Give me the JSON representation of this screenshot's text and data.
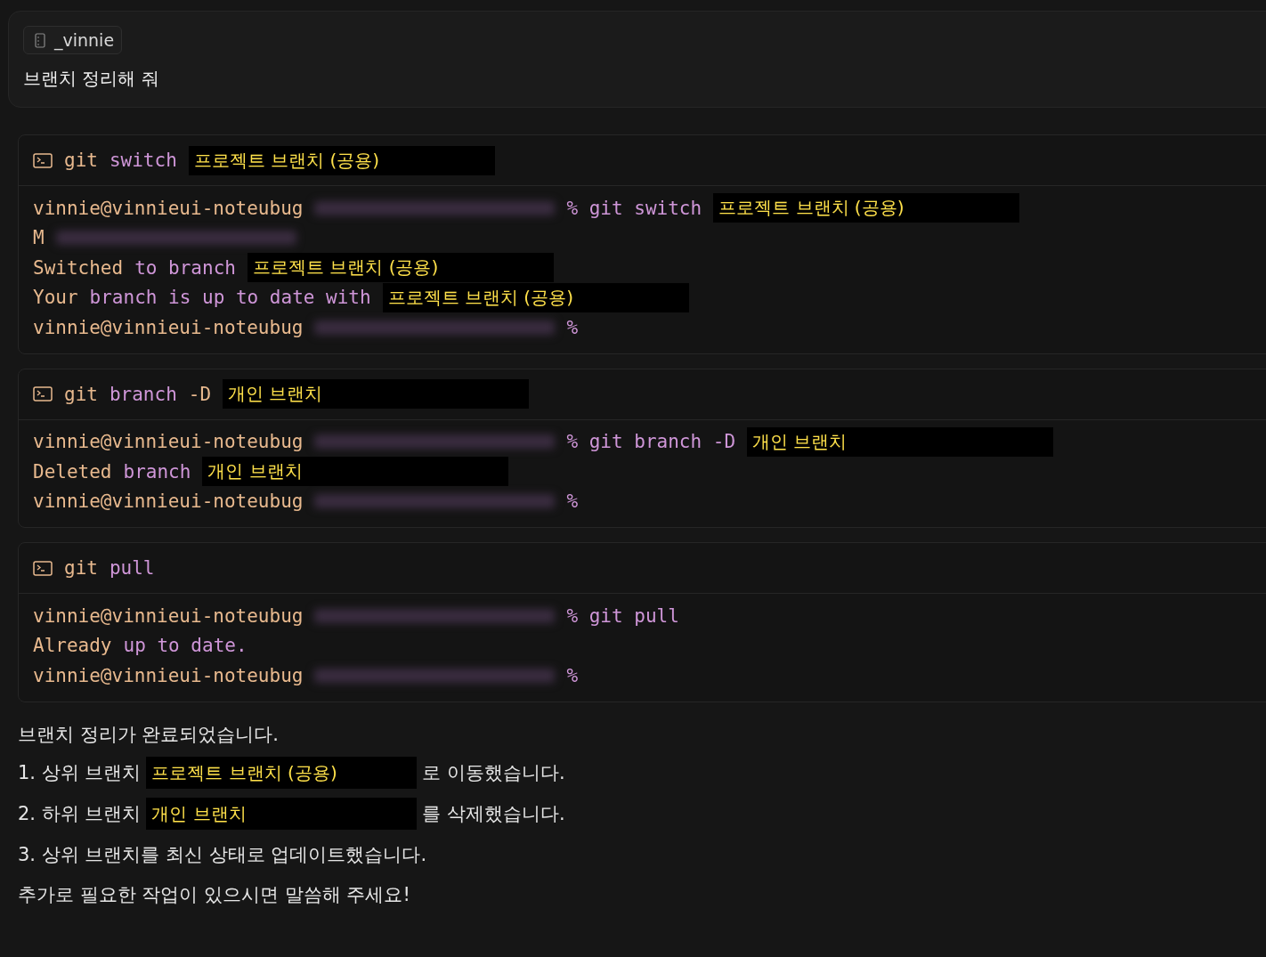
{
  "user_message": {
    "author": "_vinnie",
    "text": "브랜치 정리해 줘"
  },
  "terminals": [
    {
      "title": [
        {
          "kind": "cmd",
          "text": "git"
        },
        {
          "kind": "arg",
          "text": "switch"
        },
        {
          "kind": "redacted",
          "text": "프로젝트 브랜치 (공용)"
        }
      ],
      "lines": [
        [
          {
            "kind": "cmd",
            "text": "vinnie@vinnieui-noteubug"
          },
          {
            "kind": "blur"
          },
          {
            "kind": "arg",
            "text": "% git switch"
          },
          {
            "kind": "redacted",
            "text": "프로젝트 브랜치 (공용)"
          }
        ],
        [
          {
            "kind": "cmd",
            "text": "M"
          },
          {
            "kind": "blur"
          }
        ],
        [
          {
            "kind": "cmd",
            "text": "Switched"
          },
          {
            "kind": "arg",
            "text": "to branch"
          },
          {
            "kind": "redacted",
            "text": "프로젝트 브랜치 (공용)"
          }
        ],
        [
          {
            "kind": "cmd",
            "text": "Your"
          },
          {
            "kind": "arg",
            "text": "branch is up to date with"
          },
          {
            "kind": "redacted",
            "text": "프로젝트 브랜치 (공용)"
          }
        ],
        [
          {
            "kind": "cmd",
            "text": "vinnie@vinnieui-noteubug"
          },
          {
            "kind": "blur"
          },
          {
            "kind": "arg",
            "text": "%"
          }
        ]
      ]
    },
    {
      "title": [
        {
          "kind": "cmd",
          "text": "git"
        },
        {
          "kind": "arg",
          "text": "branch"
        },
        {
          "kind": "cmd",
          "text": "-D"
        },
        {
          "kind": "redacted",
          "text": "개인 브랜치"
        }
      ],
      "lines": [
        [
          {
            "kind": "cmd",
            "text": "vinnie@vinnieui-noteubug"
          },
          {
            "kind": "blur"
          },
          {
            "kind": "arg",
            "text": "% git branch -D"
          },
          {
            "kind": "redacted",
            "text": "개인 브랜치"
          }
        ],
        [
          {
            "kind": "cmd",
            "text": "Deleted"
          },
          {
            "kind": "arg",
            "text": "branch"
          },
          {
            "kind": "redacted",
            "text": "개인 브랜치"
          }
        ],
        [
          {
            "kind": "cmd",
            "text": "vinnie@vinnieui-noteubug"
          },
          {
            "kind": "blur"
          },
          {
            "kind": "arg",
            "text": "%"
          }
        ]
      ]
    },
    {
      "title": [
        {
          "kind": "cmd",
          "text": "git"
        },
        {
          "kind": "arg",
          "text": "pull"
        }
      ],
      "lines": [
        [
          {
            "kind": "cmd",
            "text": "vinnie@vinnieui-noteubug"
          },
          {
            "kind": "blur"
          },
          {
            "kind": "arg",
            "text": "% git pull"
          }
        ],
        [
          {
            "kind": "cmd",
            "text": "Already"
          },
          {
            "kind": "arg",
            "text": "up to date."
          }
        ],
        [
          {
            "kind": "cmd",
            "text": "vinnie@vinnieui-noteubug"
          },
          {
            "kind": "blur"
          },
          {
            "kind": "arg",
            "text": "%"
          }
        ]
      ]
    }
  ],
  "reply": {
    "intro": "브랜치 정리가 완료되었습니다.",
    "steps": [
      [
        {
          "kind": "text",
          "text": "1. 상위 브랜치"
        },
        {
          "kind": "redacted",
          "text": "프로젝트 브랜치 (공용)"
        },
        {
          "kind": "text",
          "text": "로 이동했습니다."
        }
      ],
      [
        {
          "kind": "text",
          "text": "2. 하위 브랜치"
        },
        {
          "kind": "redacted",
          "text": "개인 브랜치"
        },
        {
          "kind": "text",
          "text": "를 삭제했습니다."
        }
      ],
      [
        {
          "kind": "text",
          "text": "3. 상위 브랜치를 최신 상태로 업데이트했습니다."
        }
      ]
    ],
    "closing": "추가로 필요한 작업이 있으시면 말씀해 주세요!"
  }
}
